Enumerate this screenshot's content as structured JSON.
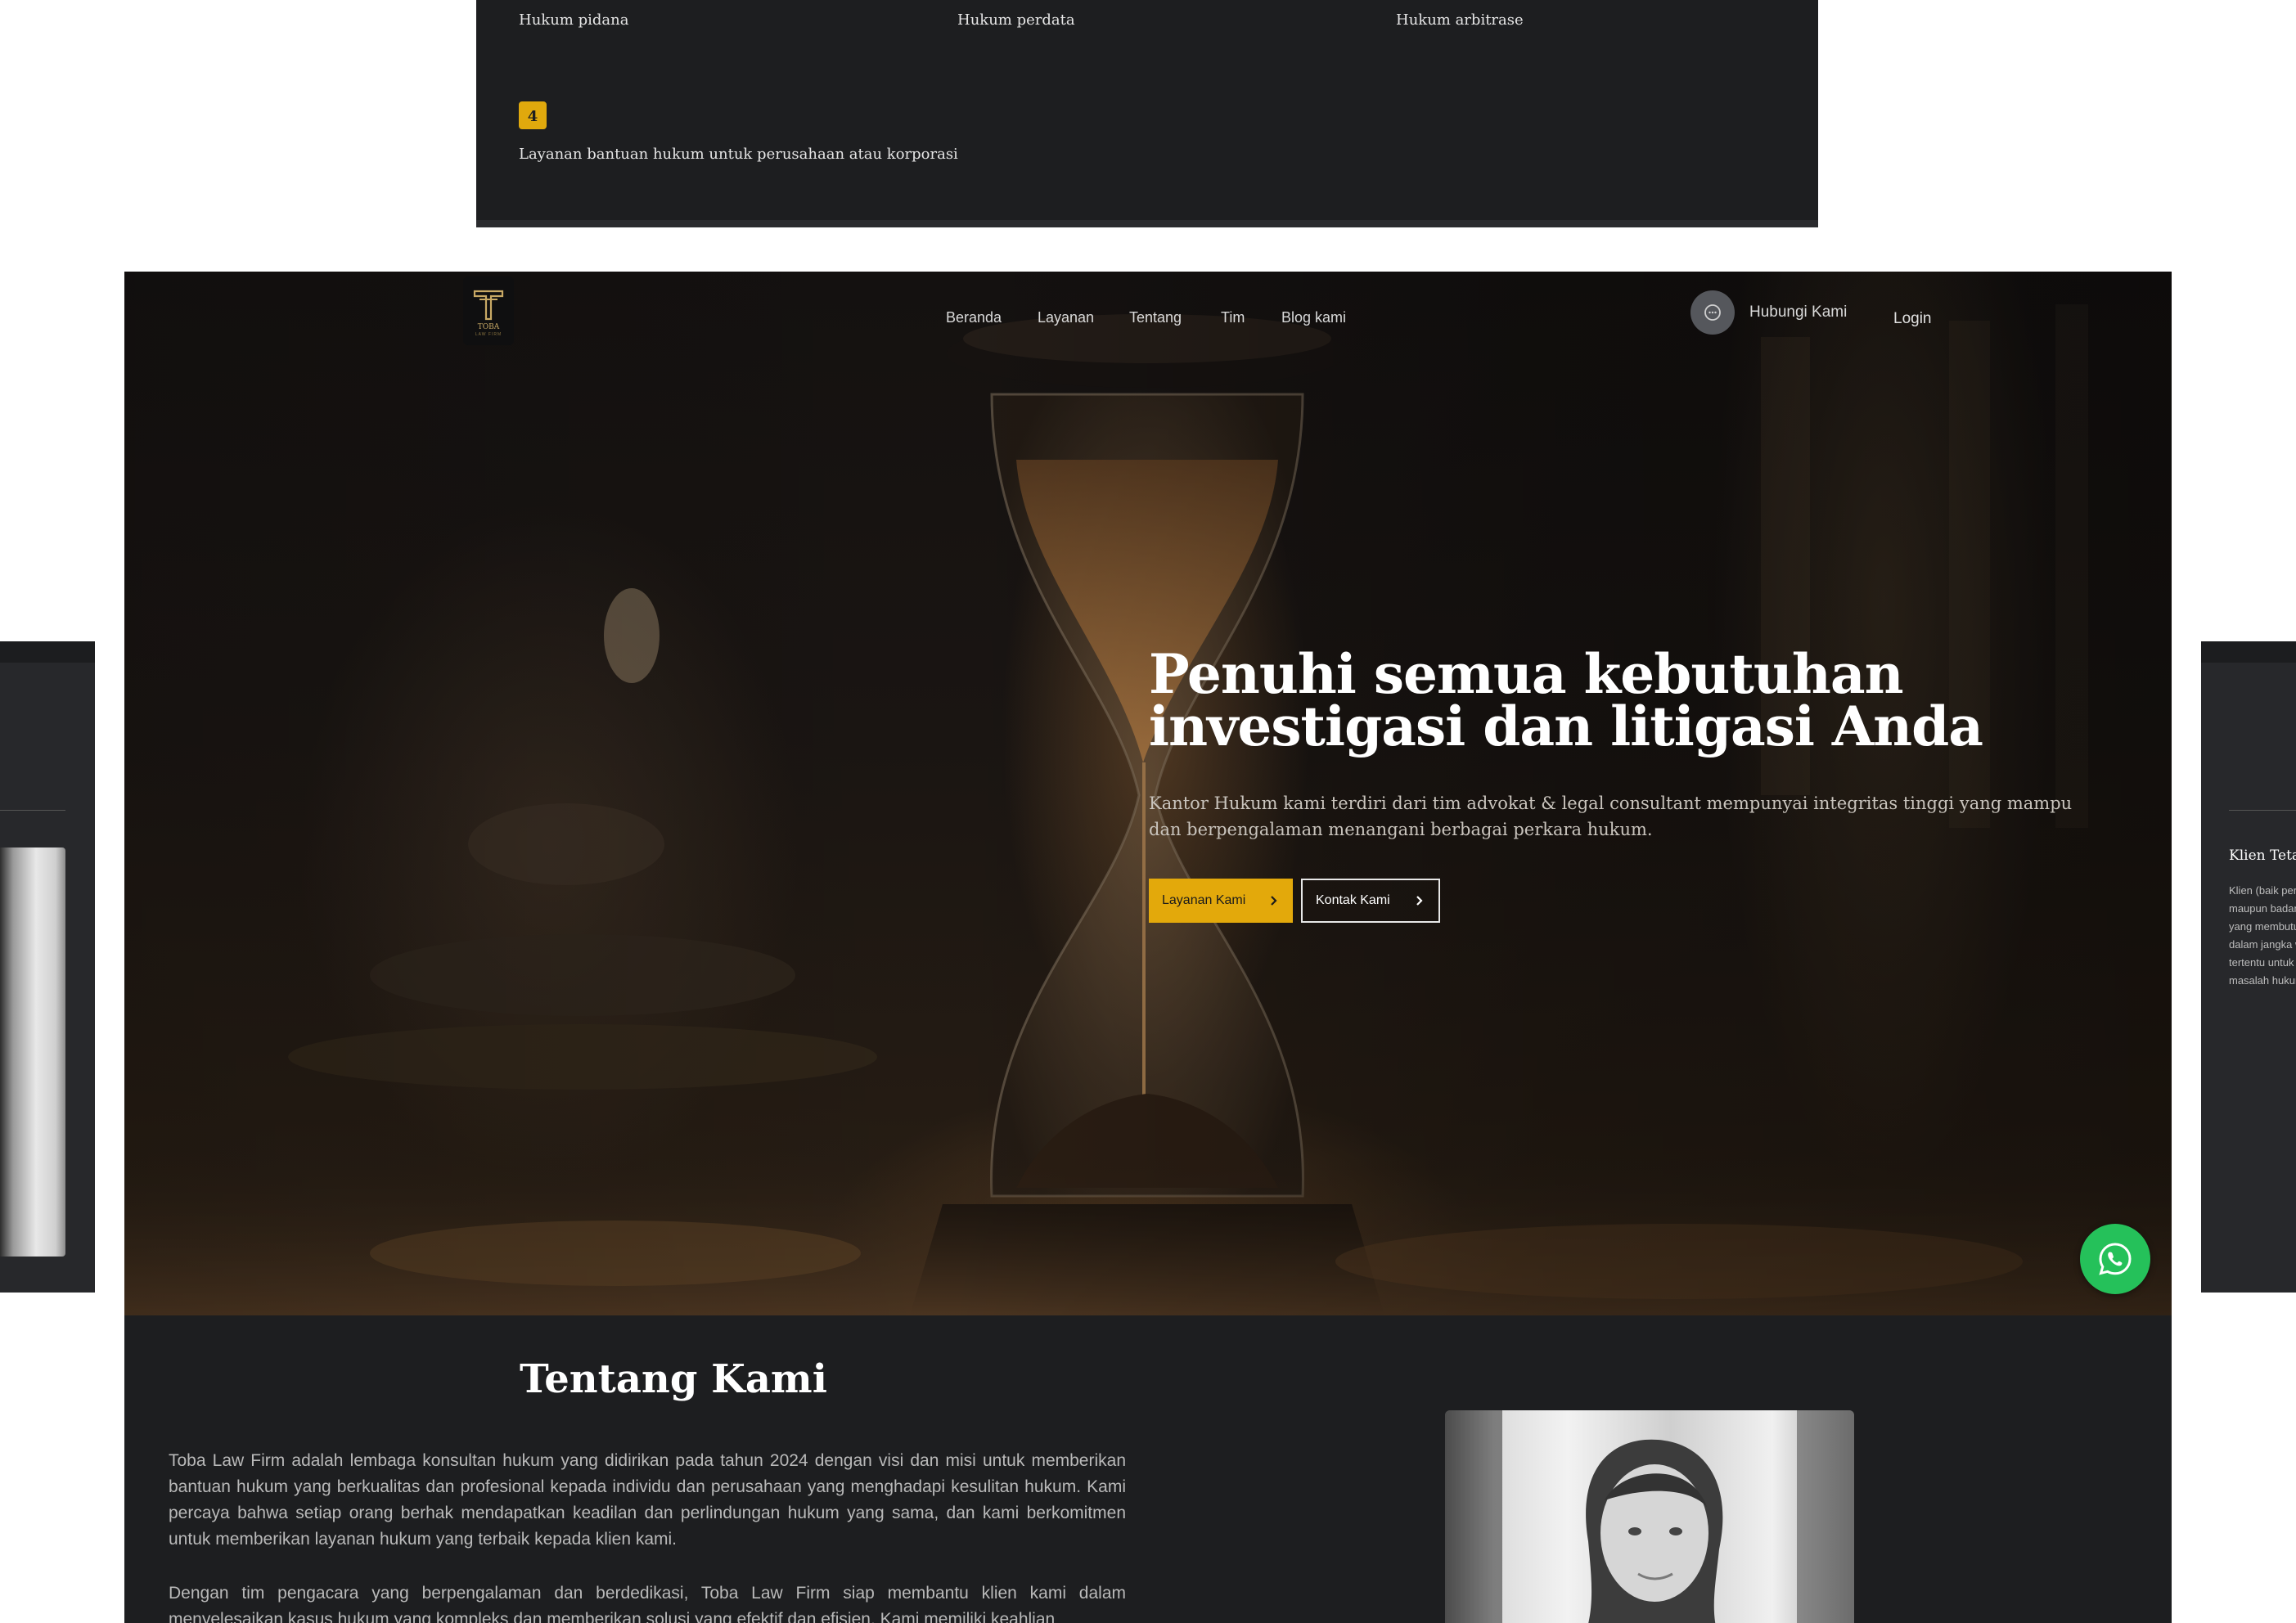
{
  "services": {
    "items": [
      "Hukum pidana",
      "Hukum perdata",
      "Hukum arbitrase"
    ],
    "badge": "4",
    "item4": "Layanan bantuan hukum untuk perusahaan atau korporasi"
  },
  "side_card": {
    "title": "Klien Tetap",
    "text": "Klien (baik perorangan maupun badan hukum) yang membutuhkan jasa dalam jangka waktu tertentu untuk menangani masalah hukum."
  },
  "brand": {
    "logo_name": "TOBA",
    "logo_tagline": "LAW FIRM"
  },
  "nav": {
    "items": [
      "Beranda",
      "Layanan",
      "Tentang",
      "Tim",
      "Blog kami"
    ],
    "contact_label": "Hubungi Kami",
    "login_label": "Login"
  },
  "hero": {
    "title": "Penuhi semua kebutuhan investigasi dan litigasi Anda",
    "description": "Kantor Hukum kami terdiri dari tim advokat & legal consultant mempunyai integritas tinggi yang mampu dan berpengalaman menangani berbagai perkara hukum.",
    "primary_button": "Layanan Kami",
    "secondary_button": "Kontak Kami"
  },
  "about": {
    "title": "Tentang Kami",
    "paragraph1": "Toba Law Firm adalah lembaga konsultan hukum yang didirikan pada tahun 2024 dengan visi dan misi untuk memberikan bantuan hukum yang berkualitas dan profesional kepada individu dan perusahaan yang menghadapi kesulitan hukum. Kami percaya bahwa setiap orang berhak mendapatkan keadilan dan perlindungan hukum yang sama, dan kami berkomitmen untuk memberikan layanan hukum yang terbaik kepada klien kami.",
    "paragraph2": "Dengan tim pengacara yang berpengalaman dan berdedikasi, Toba Law Firm siap membantu klien kami dalam menyelesaikan kasus hukum yang kompleks dan memberikan solusi yang efektif dan efisien. Kami memiliki keahlian"
  },
  "colors": {
    "accent": "#e3a90b",
    "panel": "#1d1e20",
    "whatsapp": "#25c15a"
  },
  "icons": {
    "chat": "chat-bubble-icon",
    "chevron": "chevron-right-icon",
    "whatsapp": "whatsapp-icon"
  }
}
